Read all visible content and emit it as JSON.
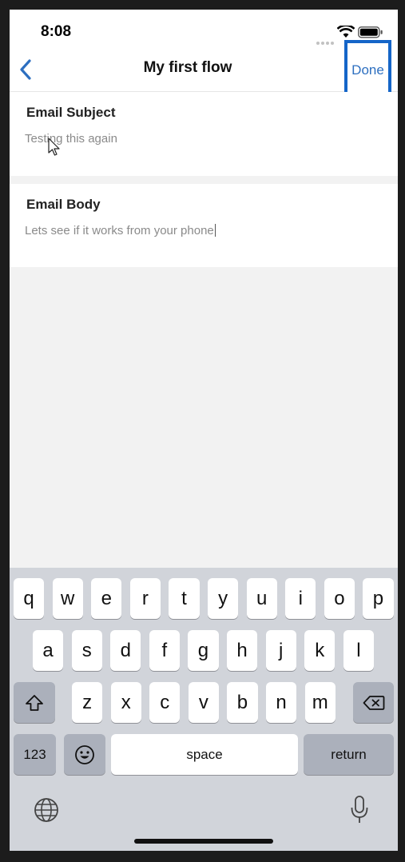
{
  "status_bar": {
    "time": "8:08"
  },
  "nav": {
    "title": "My first flow",
    "done_label": "Done"
  },
  "fields": {
    "subject": {
      "label": "Email Subject",
      "value": "Testing this again"
    },
    "body": {
      "label": "Email Body",
      "value": "Lets see if it works from your phone"
    }
  },
  "keyboard": {
    "row1": [
      "q",
      "w",
      "e",
      "r",
      "t",
      "y",
      "u",
      "i",
      "o",
      "p"
    ],
    "row2": [
      "a",
      "s",
      "d",
      "f",
      "g",
      "h",
      "j",
      "k",
      "l"
    ],
    "row3": [
      "z",
      "x",
      "c",
      "v",
      "b",
      "n",
      "m"
    ],
    "numbers_label": "123",
    "space_label": "space",
    "return_label": "return"
  },
  "colors": {
    "accent": "#2d6fc0",
    "highlight_box": "#1565c8",
    "keyboard_bg": "#d1d4da"
  }
}
